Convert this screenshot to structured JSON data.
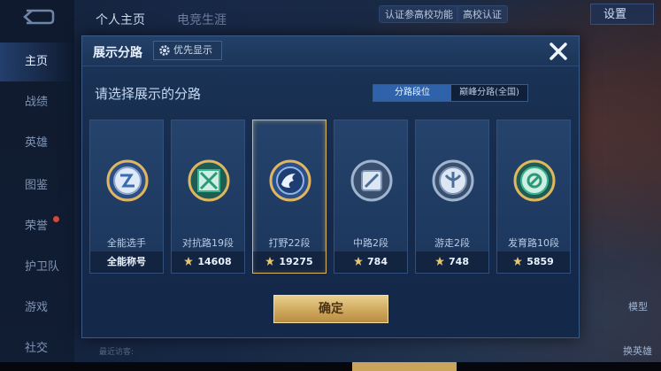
{
  "background": {
    "tabs": [
      "个人主页",
      "电竞生涯"
    ],
    "nav_items": [
      {
        "label": "主页",
        "active": true
      },
      {
        "label": "战绩",
        "active": false
      },
      {
        "label": "英雄",
        "active": false
      },
      {
        "label": "图鉴",
        "active": false
      },
      {
        "label": "荣誉",
        "active": false
      },
      {
        "label": "护卫队",
        "active": false
      },
      {
        "label": "游戏",
        "active": false
      },
      {
        "label": "社交",
        "active": false
      }
    ],
    "pill_verify": "认证参高校功能",
    "pill_school": "高校认证",
    "settings_label": "设置",
    "model_label": "模型",
    "change_hero_label": "换英雄",
    "bottom_hint": "最近访客:"
  },
  "modal": {
    "title": "展示分路",
    "priority_label": "优先显示",
    "prompt": "请选择展示的分路",
    "segments": [
      {
        "label": "分路段位",
        "active": true
      },
      {
        "label": "巅峰分路(全国)",
        "active": false
      }
    ],
    "cards": [
      {
        "name": "全能选手",
        "score": "全能称号",
        "badge": "all-round-badge-icon",
        "selected": false,
        "has_star": false
      },
      {
        "name": "对抗路19段",
        "score": "14608",
        "badge": "clash-lane-badge-icon",
        "selected": false,
        "has_star": true
      },
      {
        "name": "打野22段",
        "score": "19275",
        "badge": "jungle-badge-icon",
        "selected": true,
        "has_star": true
      },
      {
        "name": "中路2段",
        "score": "784",
        "badge": "mid-lane-badge-icon",
        "selected": false,
        "has_star": true
      },
      {
        "name": "游走2段",
        "score": "748",
        "badge": "roam-badge-icon",
        "selected": false,
        "has_star": true
      },
      {
        "name": "发育路10段",
        "score": "5859",
        "badge": "farm-lane-badge-icon",
        "selected": false,
        "has_star": true
      }
    ],
    "confirm_label": "确定"
  },
  "colors": {
    "accent_blue": "#2e63ab",
    "gold": "#cda55a",
    "selected_border": "#d8b36a"
  }
}
